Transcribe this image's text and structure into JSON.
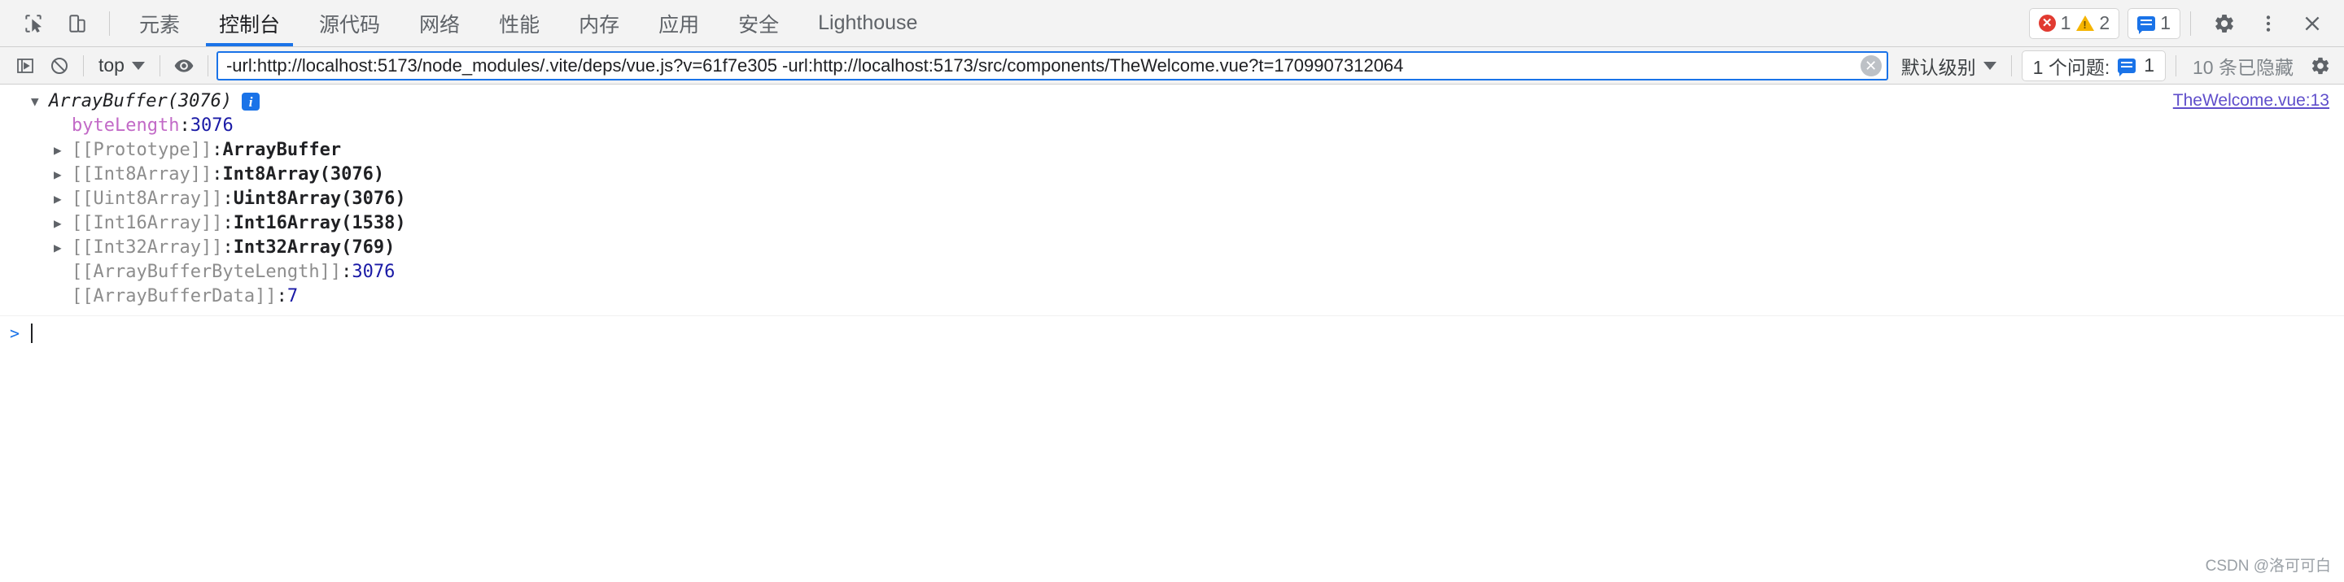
{
  "devtools": {
    "tabs": [
      {
        "label": "元素",
        "active": false
      },
      {
        "label": "控制台",
        "active": true
      },
      {
        "label": "源代码",
        "active": false
      },
      {
        "label": "网络",
        "active": false
      },
      {
        "label": "性能",
        "active": false
      },
      {
        "label": "内存",
        "active": false
      },
      {
        "label": "应用",
        "active": false
      },
      {
        "label": "安全",
        "active": false
      },
      {
        "label": "Lighthouse",
        "active": false
      }
    ],
    "status_counts": {
      "errors": "1",
      "warnings": "2",
      "messages": "1"
    }
  },
  "console_toolbar": {
    "context": "top",
    "filter_value": "-url:http://localhost:5173/node_modules/.vite/deps/vue.js?v=61f7e305 -url:http://localhost:5173/src/components/TheWelcome.vue?t=1709907312064",
    "filter_placeholder": "过滤",
    "level": "默认级别",
    "issues_label": "1 个问题:",
    "issues_count": "1",
    "hidden_label": "10 条已隐藏",
    "clear_symbol": "✕"
  },
  "console_output": {
    "source_link": "TheWelcome.vue:13",
    "root": {
      "title": "ArrayBuffer(3076)",
      "info_badge": "i",
      "expanded": true
    },
    "properties": [
      {
        "arrow": "blank",
        "name": "byteLength",
        "separator": ": ",
        "value": "3076",
        "value_type": "number",
        "name_type": "own"
      },
      {
        "arrow": "closed",
        "name": "[[Prototype]]",
        "separator": ": ",
        "value": "ArrayBuffer",
        "value_type": "object",
        "name_type": "internal"
      },
      {
        "arrow": "closed",
        "name": "[[Int8Array]]",
        "separator": ": ",
        "value": "Int8Array(3076)",
        "value_type": "object",
        "name_type": "internal"
      },
      {
        "arrow": "closed",
        "name": "[[Uint8Array]]",
        "separator": ": ",
        "value": "Uint8Array(3076)",
        "value_type": "object",
        "name_type": "internal"
      },
      {
        "arrow": "closed",
        "name": "[[Int16Array]]",
        "separator": ": ",
        "value": "Int16Array(1538)",
        "value_type": "object",
        "name_type": "internal"
      },
      {
        "arrow": "closed",
        "name": "[[Int32Array]]",
        "separator": ": ",
        "value": "Int32Array(769)",
        "value_type": "object",
        "name_type": "internal"
      },
      {
        "arrow": "blank",
        "name": "[[ArrayBufferByteLength]]",
        "separator": ": ",
        "value": "3076",
        "value_type": "number",
        "name_type": "internal"
      },
      {
        "arrow": "blank",
        "name": "[[ArrayBufferData]]",
        "separator": ": ",
        "value": "7",
        "value_type": "number",
        "name_type": "internal"
      }
    ],
    "prompt": ">"
  },
  "watermark": "CSDN @洛可可白"
}
